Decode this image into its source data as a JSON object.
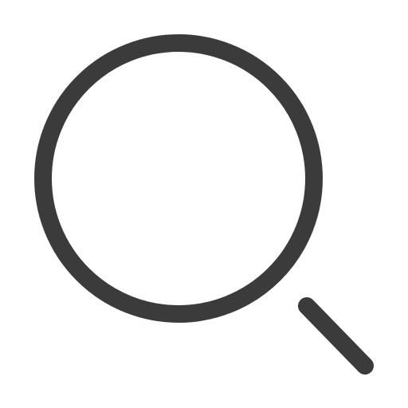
{
  "icon": {
    "name": "search-icon",
    "stroke_color": "#3b3b3b",
    "background_color": "#ffffff"
  }
}
